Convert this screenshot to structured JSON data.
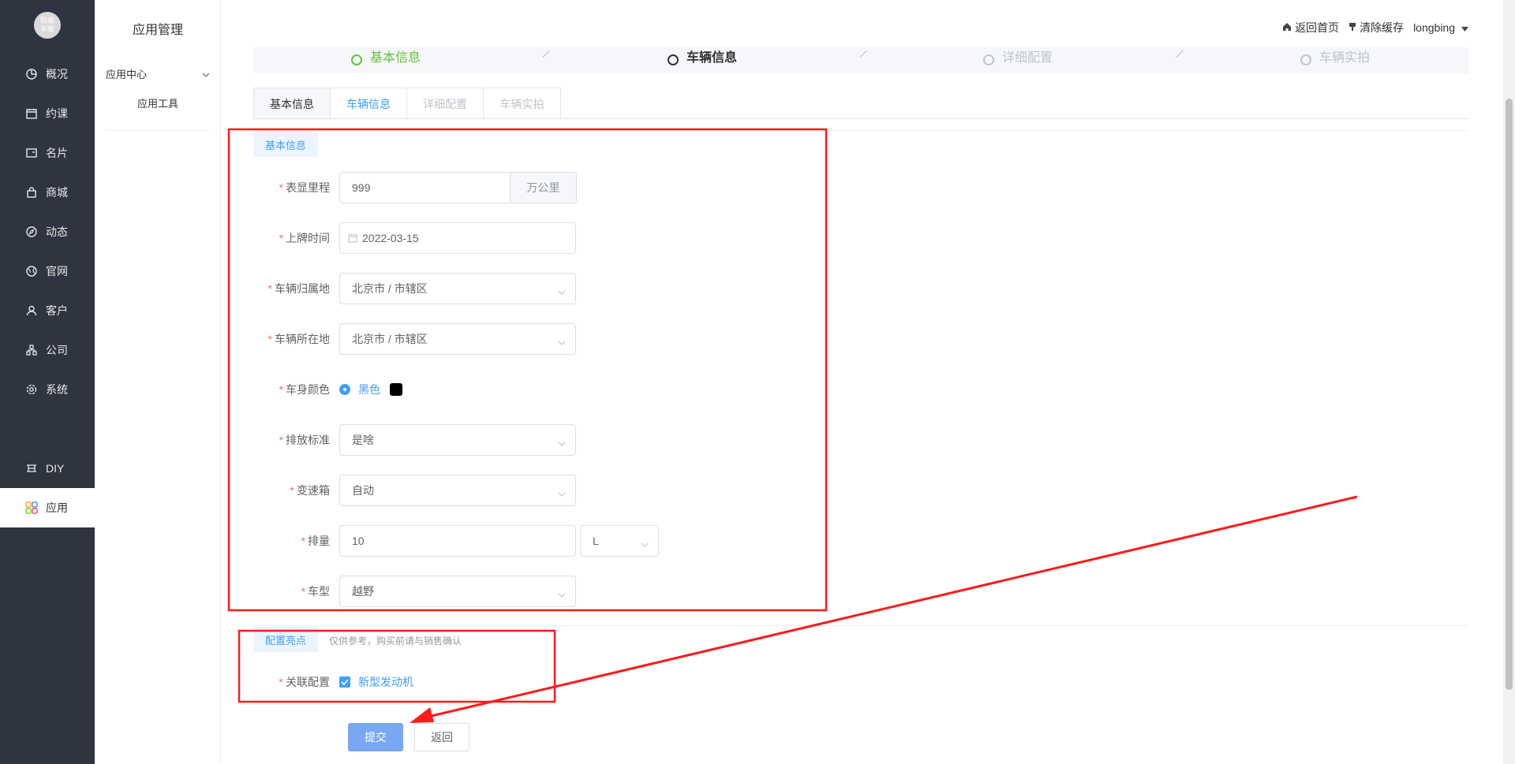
{
  "sidebar": {
    "logo_text": "阳载\n车贩",
    "items": [
      {
        "label": "概况",
        "icon": "pie-chart-icon"
      },
      {
        "label": "约课",
        "icon": "calendar-icon"
      },
      {
        "label": "名片",
        "icon": "card-icon"
      },
      {
        "label": "商城",
        "icon": "shopping-bag-icon"
      },
      {
        "label": "动态",
        "icon": "compass-icon"
      },
      {
        "label": "官网",
        "icon": "globe-icon"
      },
      {
        "label": "客户",
        "icon": "user-icon"
      },
      {
        "label": "公司",
        "icon": "org-chart-icon"
      },
      {
        "label": "系统",
        "icon": "gear-icon"
      }
    ],
    "diy": {
      "label": "DIY",
      "icon": "diy-icon"
    },
    "app": {
      "label": "应用",
      "icon": "apps-icon"
    }
  },
  "submenu": {
    "title": "应用管理",
    "group": "应用中心",
    "item": "应用工具"
  },
  "header": {
    "home": "返回首页",
    "clear_cache": "清除缓存",
    "user": "longbing"
  },
  "steps": [
    {
      "label": "基本信息",
      "state": "done"
    },
    {
      "label": "车辆信息",
      "state": "current"
    },
    {
      "label": "详细配置",
      "state": "todo"
    },
    {
      "label": "车辆实拍",
      "state": "todo"
    }
  ],
  "tabs": [
    "基本信息",
    "车辆信息",
    "详细配置",
    "车辆实拍"
  ],
  "sections": {
    "basic": "基本信息",
    "config": "配置亮点",
    "config_hint": "仅供参考，购买前请与销售确认"
  },
  "form": {
    "mileage": {
      "label": "表显里程",
      "value": "999",
      "unit": "万公里"
    },
    "reg_date": {
      "label": "上牌时间",
      "value": "2022-03-15"
    },
    "home_city": {
      "label": "车辆归属地",
      "value": "北京市 / 市辖区"
    },
    "location": {
      "label": "车辆所在地",
      "value": "北京市 / 市辖区"
    },
    "color": {
      "label": "车身颜色",
      "option": "黑色",
      "swatch": "#000000"
    },
    "emission": {
      "label": "排放标准",
      "value": "是啥"
    },
    "gearbox": {
      "label": "变速箱",
      "value": "自动"
    },
    "displacement": {
      "label": "排量",
      "value": "10",
      "unit": "L"
    },
    "model": {
      "label": "车型",
      "value": "越野"
    },
    "linked": {
      "label": "关联配置",
      "option": "新型发动机"
    }
  },
  "buttons": {
    "submit": "提交",
    "back": "返回"
  },
  "colors": {
    "sidebar": "#2e3440",
    "primary": "#409eff",
    "annotation": "#ff1a1a"
  }
}
